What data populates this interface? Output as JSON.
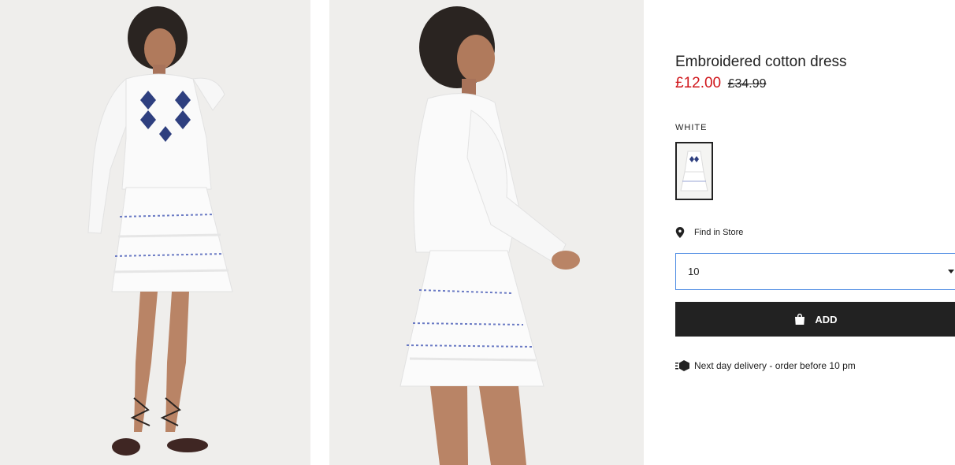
{
  "product": {
    "title": "Embroidered cotton dress",
    "price_sale": "£12.00",
    "price_original": "£34.99"
  },
  "color": {
    "label": "WHITE",
    "selected_swatch_icon": "dress-thumbnail"
  },
  "store": {
    "find_label": "Find in Store",
    "icon": "location-pin-icon"
  },
  "size_select": {
    "value": "10",
    "icon": "chevron-down-icon"
  },
  "add_button": {
    "label": "ADD",
    "icon": "shopping-bag-icon"
  },
  "delivery": {
    "text": "Next day delivery - order before 10 pm",
    "icon": "delivery-truck-icon"
  },
  "colors": {
    "sale_price": "#d0171c",
    "button_bg": "#222222",
    "select_border": "#4d8be3",
    "photo_bg": "#efeeec"
  }
}
